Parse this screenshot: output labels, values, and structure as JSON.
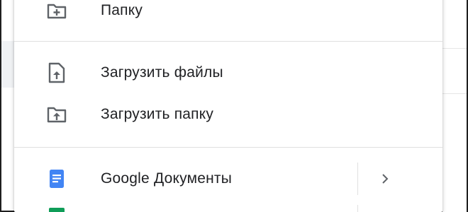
{
  "menu": {
    "items": [
      {
        "label": "Папку",
        "icon": "folder-plus-icon"
      },
      {
        "label": "Загрузить файлы",
        "icon": "file-upload-icon"
      },
      {
        "label": "Загрузить папку",
        "icon": "folder-upload-icon"
      },
      {
        "label": "Google Документы",
        "icon": "google-docs-icon",
        "submenu_icon": "chevron-right-icon"
      }
    ]
  },
  "colors": {
    "icon_gray": "#5f6368",
    "docs_blue": "#4285f4",
    "sheets_green": "#0f9d58",
    "separator": "#e0e0e0"
  }
}
